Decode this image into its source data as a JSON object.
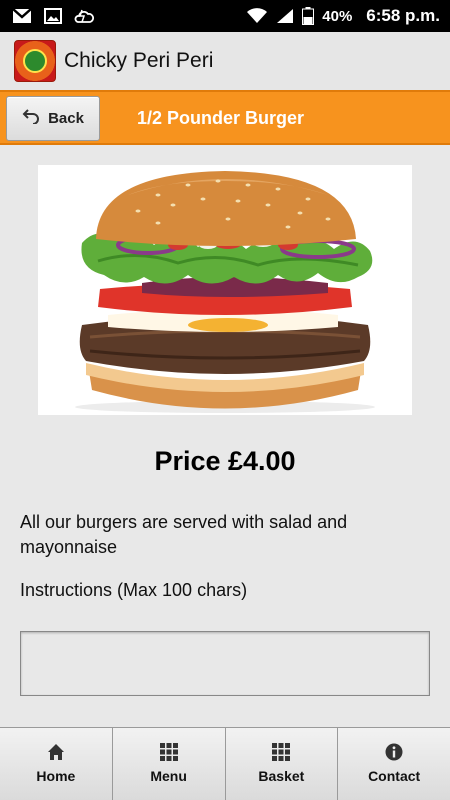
{
  "status_bar": {
    "battery": "40%",
    "time": "6:58 p.m."
  },
  "app": {
    "title": "Chicky Peri Peri"
  },
  "header": {
    "back_label": "Back",
    "title": "1/2 Pounder Burger"
  },
  "product": {
    "price": "Price £4.00",
    "description": "All our burgers are served with salad and mayonnaise",
    "instructions_label": "Instructions (Max 100 chars)",
    "instructions_value": ""
  },
  "nav": {
    "items": [
      {
        "label": "Home",
        "icon": "home-icon"
      },
      {
        "label": "Menu",
        "icon": "grid-icon"
      },
      {
        "label": "Basket",
        "icon": "grid-icon"
      },
      {
        "label": "Contact",
        "icon": "info-icon"
      }
    ]
  },
  "colors": {
    "accent": "#f7931e",
    "background": "#e8e8e8"
  }
}
